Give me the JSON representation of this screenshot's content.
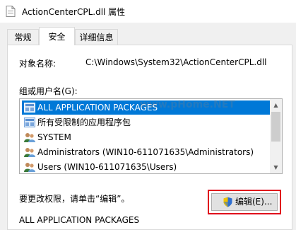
{
  "window": {
    "title": "ActionCenterCPL.dll 属性"
  },
  "tabs": [
    {
      "label": "常规",
      "active": false
    },
    {
      "label": "安全",
      "active": true
    },
    {
      "label": "详细信息",
      "active": false
    }
  ],
  "security": {
    "object_name_label": "对象名称:",
    "object_name_value": "C:\\Windows\\System32\\ActionCenterCPL.dll",
    "group_label": "组或用户名(G):",
    "entries": [
      {
        "label": "ALL APPLICATION PACKAGES",
        "icon": "app-package-icon",
        "selected": true
      },
      {
        "label": "所有受限制的应用程序包",
        "icon": "app-package-icon",
        "selected": false
      },
      {
        "label": "SYSTEM",
        "icon": "user-group-icon",
        "selected": false
      },
      {
        "label": "Administrators (WIN10-611071635\\Administrators)",
        "icon": "user-group-icon",
        "selected": false
      },
      {
        "label": "Users (WIN10-611071635\\Users)",
        "icon": "user-group-icon",
        "selected": false
      }
    ],
    "hint": "要更改权限，请单击“编辑”。",
    "edit_button_label": "编辑(E)...",
    "permissions_for_label": "ALL APPLICATION PACKAGES"
  },
  "watermark": {
    "text": "www.pHome.NET"
  },
  "colors": {
    "selection": "#0078d7",
    "highlight_border": "#e0001b"
  }
}
